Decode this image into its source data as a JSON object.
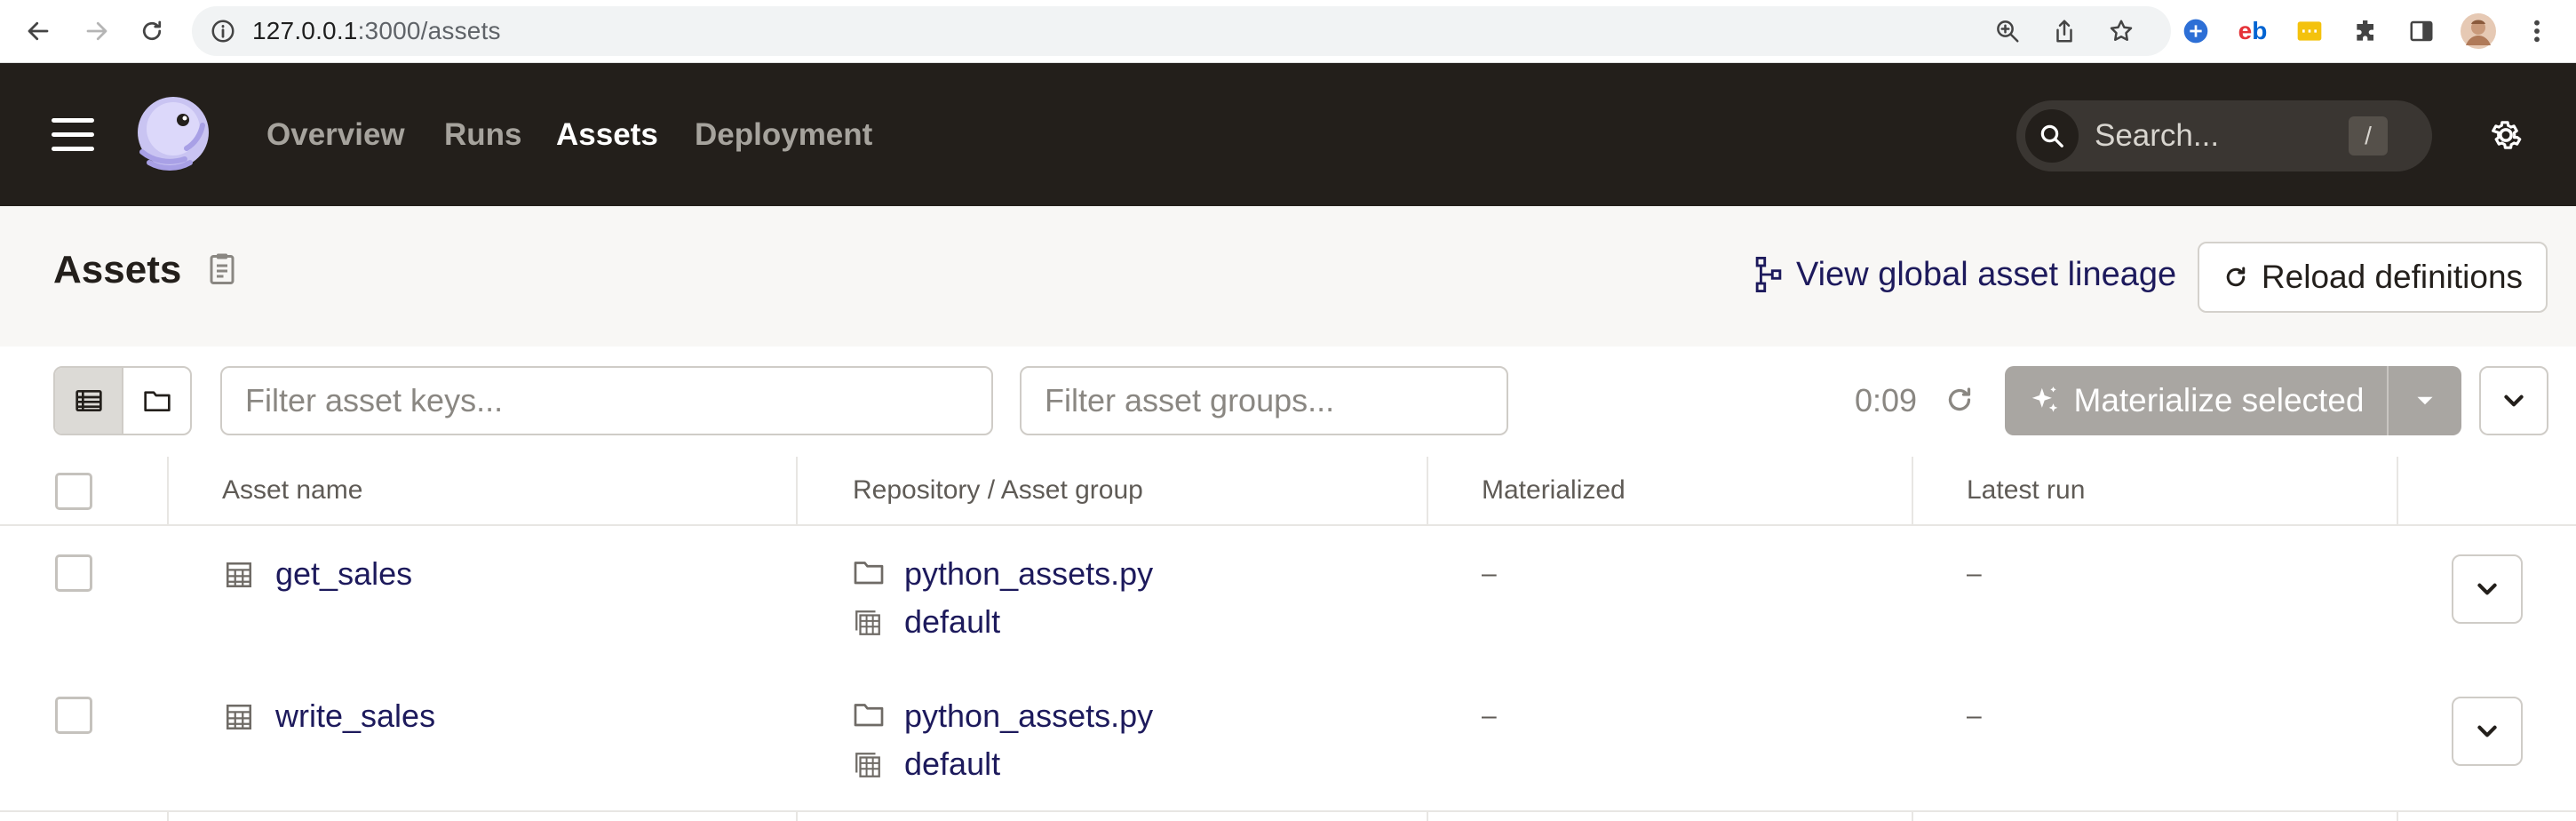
{
  "browser": {
    "url_host": "127.0.0.1",
    "url_rest": ":3000/assets",
    "icons": [
      "back-icon",
      "forward-icon",
      "reload-icon",
      "info-icon",
      "zoom-icon",
      "share-icon",
      "star-icon",
      "extension-icon",
      "puzzle-icon",
      "sidepanel-icon",
      "profile-avatar",
      "menu-icon"
    ]
  },
  "nav": {
    "links": [
      {
        "label": "Overview",
        "active": false
      },
      {
        "label": "Runs",
        "active": false
      },
      {
        "label": "Assets",
        "active": true
      },
      {
        "label": "Deployment",
        "active": false
      }
    ],
    "search_placeholder": "Search...",
    "search_shortcut": "/"
  },
  "header": {
    "title": "Assets",
    "lineage_link": "View global asset lineage",
    "reload_button": "Reload definitions"
  },
  "toolbar": {
    "filter_keys_placeholder": "Filter asset keys...",
    "filter_groups_placeholder": "Filter asset groups...",
    "timer": "0:09",
    "materialize_button": "Materialize selected"
  },
  "table": {
    "columns": [
      "Asset name",
      "Repository / Asset group",
      "Materialized",
      "Latest run"
    ],
    "rows": [
      {
        "name": "get_sales",
        "repository": "python_assets.py",
        "group": "default",
        "materialized": "–",
        "latest_run": "–"
      },
      {
        "name": "write_sales",
        "repository": "python_assets.py",
        "group": "default",
        "materialized": "–",
        "latest_run": "–"
      }
    ]
  },
  "colors": {
    "nav_bg": "#231f1b",
    "link": "#1d1a5c",
    "materialize_bg": "#a9a6a2"
  }
}
